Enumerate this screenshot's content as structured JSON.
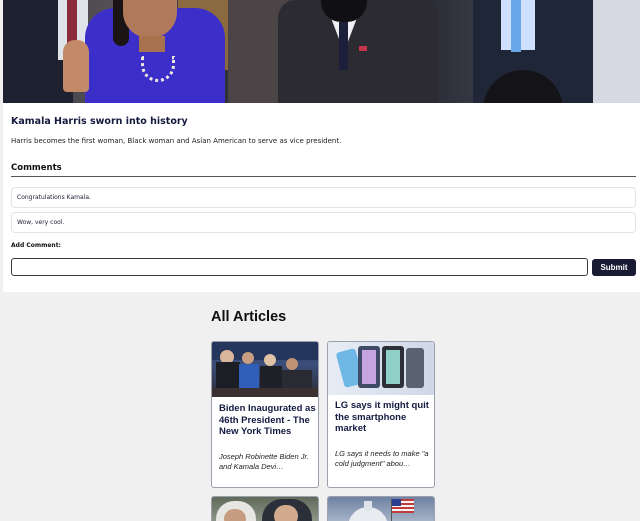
{
  "featured": {
    "image_alt": "kamala-harris-swearing-in-photo",
    "title": "Kamala Harris sworn into history",
    "description": "Harris becomes the first woman, Black woman and Asian American to serve as vice president."
  },
  "comments": {
    "heading": "Comments",
    "items": [
      {
        "text": "Congratulations Kamala."
      },
      {
        "text": "Wow, very cool."
      }
    ],
    "add_label": "Add Comment:",
    "input_value": "",
    "input_placeholder": "",
    "submit_label": "Submit"
  },
  "articles": {
    "heading": "All Articles",
    "items": [
      {
        "image": "biden-inauguration-photo",
        "title": "Biden Inaugurated as 46th President - The New York Times",
        "description": "Joseph Robinette Biden Jr. and Kamala Devi…"
      },
      {
        "image": "lg-smartphones-photo",
        "title": "LG says it might quit the smartphone market",
        "description": "LG says it needs to make \"a cold judgment\" abou…"
      },
      {
        "image": "news-photo-men",
        "title": "",
        "description": ""
      },
      {
        "image": "capitol-flag-photo",
        "title": "",
        "description": ""
      }
    ]
  },
  "colors": {
    "accent": "#181b33",
    "title_navy": "#151a3e",
    "page_bg": "#f0f0f0"
  }
}
